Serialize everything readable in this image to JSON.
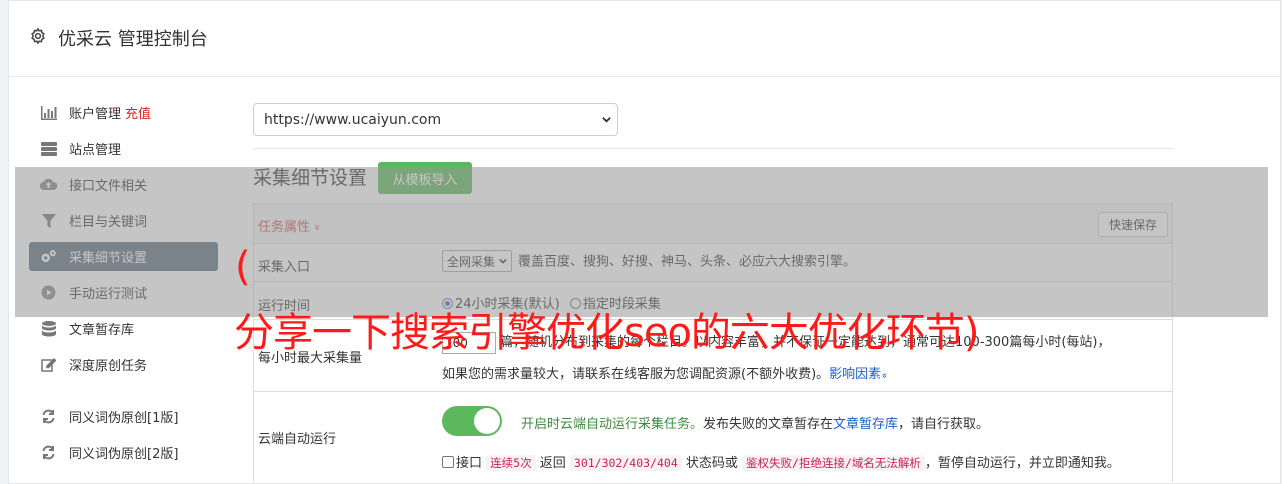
{
  "header": {
    "title": "优采云 管理控制台"
  },
  "sidebar": {
    "items": [
      {
        "label": "账户管理",
        "extra": "充值",
        "icon": "bar-chart-icon"
      },
      {
        "label": "站点管理",
        "icon": "server-icon"
      },
      {
        "label": "接口文件相关",
        "icon": "cloud-upload-icon"
      },
      {
        "label": "栏目与关键词",
        "icon": "filter-icon"
      },
      {
        "label": "采集细节设置",
        "icon": "gears-icon",
        "active": true
      },
      {
        "label": "手动运行测试",
        "icon": "play-circle-icon"
      },
      {
        "label": "文章暂存库",
        "icon": "database-icon"
      },
      {
        "label": "深度原创任务",
        "icon": "edit-icon"
      },
      {
        "label": "同义词伪原创[1版]",
        "icon": "refresh-icon"
      },
      {
        "label": "同义词伪原创[2版]",
        "icon": "refresh-icon"
      }
    ]
  },
  "main": {
    "site_select": "https://www.ucaiyun.com",
    "section_title": "采集细节设置",
    "import_button": "从模板导入",
    "table": {
      "header_label": "任务属性",
      "header_chevron": "»",
      "save_button": "快速保存",
      "rows": {
        "entry": {
          "label": "采集入口",
          "select": "全网采集",
          "desc": "覆盖百度、搜狗、好搜、神马、头条、必应六大搜索引擎。"
        },
        "runtime": {
          "label": "运行时间",
          "option1": "24小时采集(默认)",
          "option2": "指定时段采集"
        },
        "maxcount": {
          "label": "每小时最大采集量",
          "input": "100",
          "line1_a": "篇，随机分布到采集的每个栏目。以内容丰富，并不保证一定能达到，通常可达100-300篇每小时(每站)，",
          "line2": "如果您的需求量较大，请联系在线客服为您调配资源(不额外收费)。",
          "factor_link": "影响因素",
          "factor_chevron": "»"
        },
        "cloud": {
          "label": "云端自动运行",
          "green_text": "开启时云端自动运行采集任务。",
          "text_a": "发布失败的文章暂存在",
          "link": "文章暂存库",
          "text_b": "，请自行获取。",
          "cb_label": "接口",
          "code1": "连续5次",
          "t1": "返回",
          "code2": "301/302/403/404",
          "t2": "状态码或",
          "code3": "鉴权失败/拒绝连接/域名无法解析",
          "t3": "，暂停自动运行，并立即通知我。"
        }
      }
    }
  },
  "overlay": {
    "paren": "(",
    "title": "分享一下搜索引擎优化seo的六大优化环节)"
  }
}
